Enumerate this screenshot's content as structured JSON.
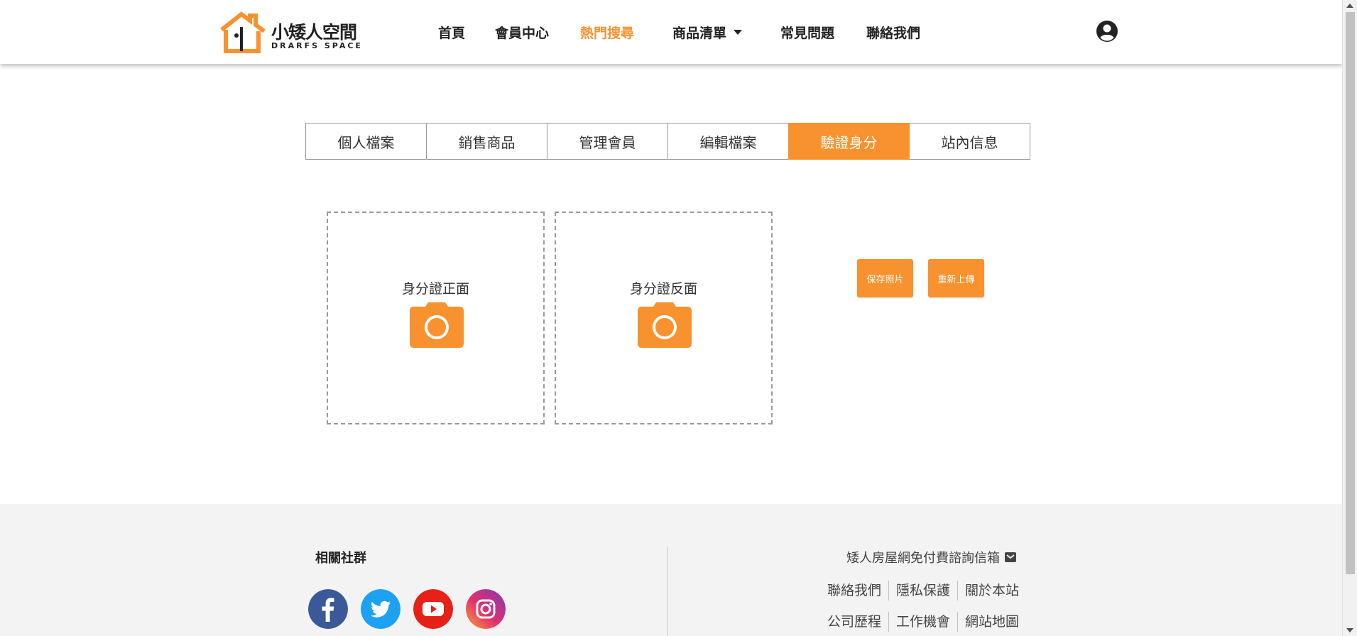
{
  "brand": {
    "name": "小矮人空間",
    "subtitle": "DRARFS SPACE",
    "color_primary": "#f7922e"
  },
  "nav": {
    "items": [
      {
        "label": "首頁",
        "active": false
      },
      {
        "label": "會員中心",
        "active": false
      },
      {
        "label": "熱門搜尋",
        "active": true
      },
      {
        "label": "商品清單",
        "active": false,
        "dropdown": true
      },
      {
        "label": "常見問題",
        "active": false
      },
      {
        "label": "聯絡我們",
        "active": false
      }
    ],
    "user_icon": "user-circle-icon"
  },
  "tabs": [
    {
      "label": "個人檔案",
      "active": false
    },
    {
      "label": "銷售商品",
      "active": false
    },
    {
      "label": "管理會員",
      "active": false
    },
    {
      "label": "編輯檔案",
      "active": false
    },
    {
      "label": "驗證身分",
      "active": true
    },
    {
      "label": "站內信息",
      "active": false
    }
  ],
  "upload": {
    "front_label": "身分證正面",
    "back_label": "身分證反面",
    "icon": "camera-icon"
  },
  "actions": {
    "save_label": "保存照片",
    "reupload_label": "重新上傳"
  },
  "footer": {
    "social_title": "相關社群",
    "social": [
      "facebook-icon",
      "twitter-icon",
      "youtube-icon",
      "instagram-icon"
    ],
    "contact_text": "矮人房屋網免付費諮詢信箱",
    "links_row1": [
      "聯絡我們",
      "隱私保護",
      "關於本站"
    ],
    "links_row2": [
      "公司歷程",
      "工作機會",
      "網站地圖"
    ]
  }
}
